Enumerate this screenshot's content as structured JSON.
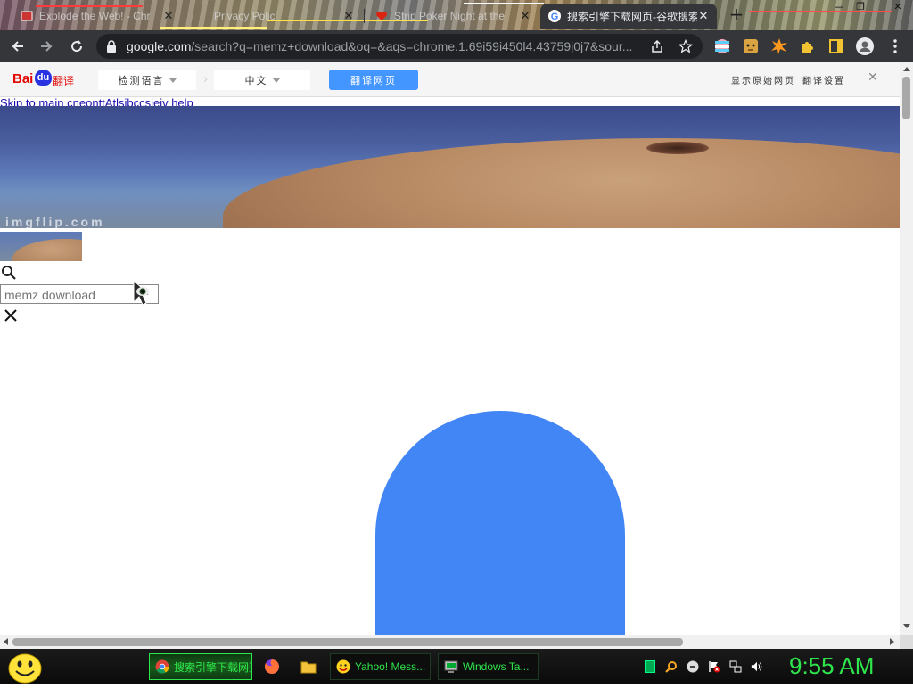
{
  "browser": {
    "tabs": [
      {
        "title": "Explode the Web! - Chr",
        "favicon": "app-icon",
        "active": false
      },
      {
        "title": "Privacy Polic",
        "favicon": "blank-page-icon",
        "active": false
      },
      {
        "title": "Strip Poker Night at the",
        "favicon": "heart-icon",
        "active": false
      },
      {
        "title": "搜索引擎下载网页-谷歌搜索",
        "favicon": "google-icon",
        "active": true
      }
    ],
    "new_tab_label": "+",
    "url_host": "google.com",
    "url_rest": "/search?q=memz+download&oq=&aqs=chrome.1.69i59i450l4.43759j0j7&sour...",
    "window_controls": [
      "—",
      "❐",
      "✕"
    ]
  },
  "translate_bar": {
    "logo_text_1": "Bai",
    "logo_text_2": "du",
    "logo_text_3": "翻译",
    "source_lang": "检测语言",
    "target_lang": "中文",
    "swap_glyph": "›",
    "translate_button": "翻译网页",
    "link_1": "显示原始网页",
    "link_2": "翻译设置",
    "close_glyph": "✕"
  },
  "page": {
    "skip_link": "Skip to main cneonttAtlsibccsiejv help",
    "banner_watermark": "imgflip.com",
    "search_placeholder": "memz download",
    "clear_glyph": "✕"
  },
  "taskbar": {
    "tasks": [
      {
        "label": "搜索引擎下载网页-谷歌 - ...",
        "icon": "chrome-icon",
        "active": true
      },
      {
        "label": "",
        "icon": "firefox-icon",
        "active": false
      },
      {
        "label": "",
        "icon": "folder-icon",
        "active": false
      },
      {
        "label": "Yahoo! Mess...",
        "icon": "yahoo-messenger-icon",
        "active": false
      },
      {
        "label": "Windows Ta...",
        "icon": "task-manager-icon",
        "active": false
      }
    ],
    "clock": "9:55 AM"
  },
  "colors": {
    "accent_blue": "#4285f4",
    "baidu_blue": "#4395ff",
    "taskbar_green": "#2ee64b",
    "toolbar_dark": "#35363a"
  }
}
